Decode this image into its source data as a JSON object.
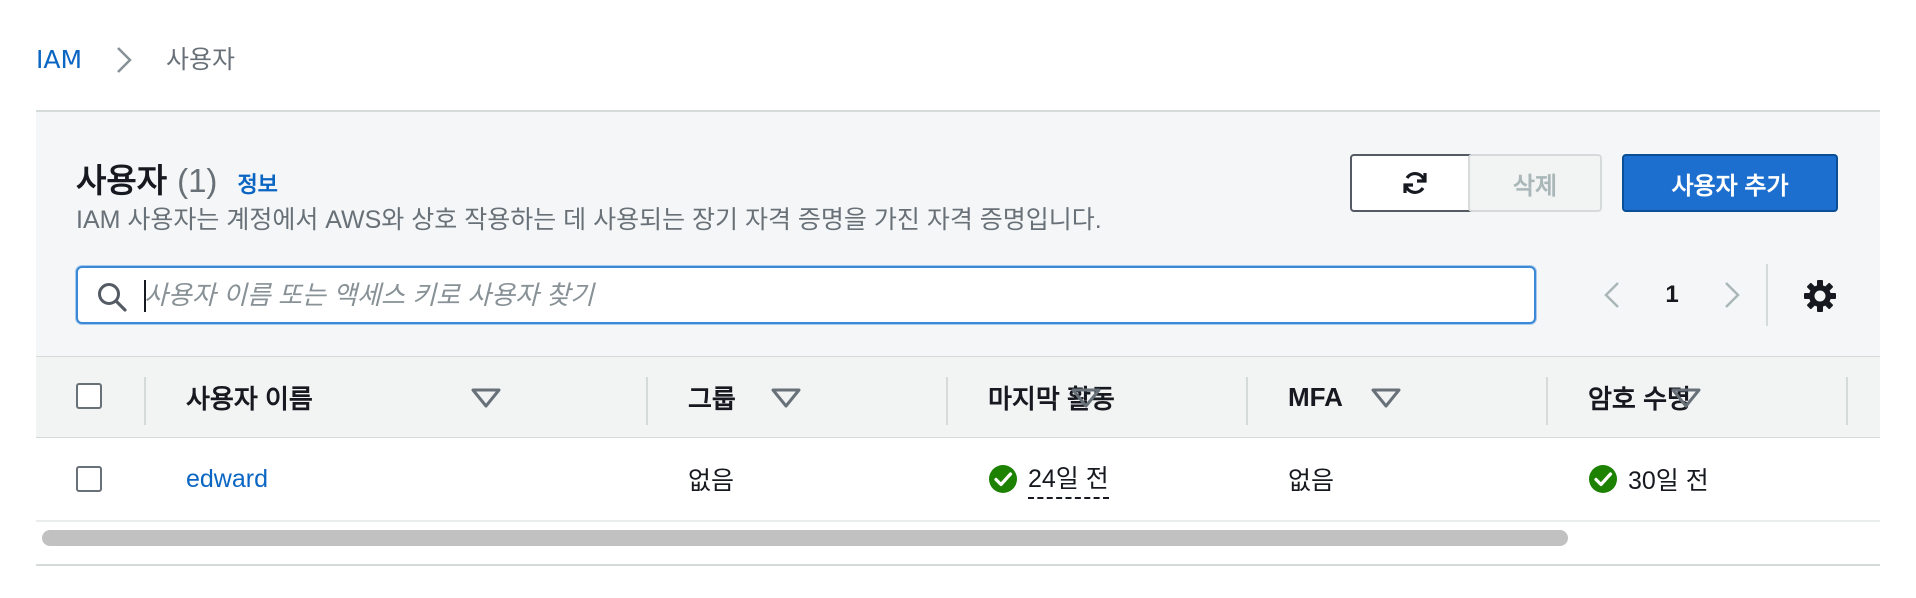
{
  "breadcrumb": {
    "root": "IAM",
    "current": "사용자"
  },
  "header": {
    "title": "사용자",
    "count": "(1)",
    "info_link": "정보",
    "description": "IAM 사용자는 계정에서 AWS와 상호 작용하는 데 사용되는 장기 자격 증명을 가진 자격 증명입니다."
  },
  "toolbar": {
    "refresh_icon": "refresh-icon",
    "delete_label": "삭제",
    "add_user_label": "사용자 추가"
  },
  "search": {
    "placeholder": "사용자 이름 또는 액세스 키로 사용자 찾기",
    "value": ""
  },
  "pagination": {
    "current_page": "1"
  },
  "table": {
    "columns": [
      {
        "label": "사용자 이름"
      },
      {
        "label": "그룹"
      },
      {
        "label": "마지막 활동"
      },
      {
        "label": "MFA"
      },
      {
        "label": "암호 수명"
      }
    ],
    "rows": [
      {
        "username": "edward",
        "groups": "없음",
        "last_activity": "24일 전",
        "mfa": "없음",
        "password_age": "30일 전"
      }
    ]
  },
  "colors": {
    "link": "#0b66c3",
    "primary_button": "#1d6fcf",
    "success": "#1d8102",
    "header_bg": "#f5f6f7"
  }
}
